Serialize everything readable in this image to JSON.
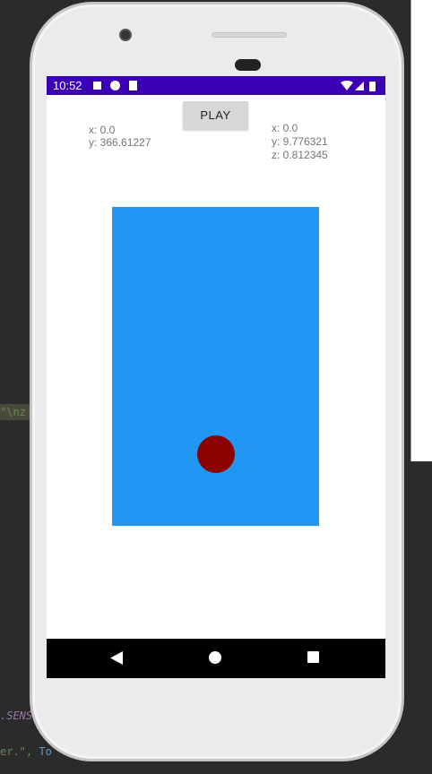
{
  "background_code": {
    "line1": "\"\\nz",
    "line2": ".SENS",
    "line3_a": "er.\", ",
    "line3_b": "To"
  },
  "status_bar": {
    "time": "10:52",
    "color": "#3b00b4"
  },
  "play_button": {
    "label": "PLAY"
  },
  "position_readout": {
    "x": "x: 0.0",
    "y": "y: 366.61227"
  },
  "sensor_readout": {
    "x": "x: 0.0",
    "y": "y: 9.776321",
    "z": "z: 0.812345"
  },
  "game": {
    "field_color": "#2196f3",
    "ball_color": "#8b0000"
  },
  "nav_bar": {
    "icons": [
      "back-icon",
      "home-icon",
      "recents-icon"
    ]
  }
}
